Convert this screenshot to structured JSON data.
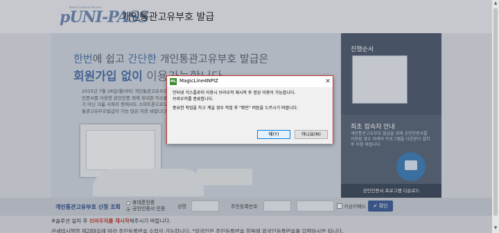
{
  "header": {
    "logo_small_text": "Korea Customs Service",
    "logo_brand": "pUNI-PASS",
    "page_title": "개인통관고유부호 발급"
  },
  "hero": {
    "line1_a": "한번",
    "line1_b": "에 쉽고 ",
    "line1_c": "간단한",
    "line1_d": " 개인통관고유부호 발급은",
    "line2_a": "회원가입 없이",
    "line2_b": " 이용가능합니다",
    "paragraph": "2015년 7월 28일(월)부터 개인통관고유부호 공인인증서를 이용한 본인인증 외에 휴대폰 익스플로러가 아닌 크롬 사파리 등에서도 스마트폰으로도 개인통관고유부호발급이 가능 많은 이용 바랍니다."
  },
  "right_panel": {
    "title1": "진행순서",
    "title2": "최초 접속자 안내",
    "text": "개인통관고유부호 발급을 위해 공인인증서를 이용할 경우 아래의 프로그램을 다운받아 설치 후 이용 바랍니다.",
    "download_label": "공인인증서 프로그램 다운로드"
  },
  "form": {
    "title": "개인통관고유부호 신청 조회",
    "radio_phone": "휴대폰인증",
    "radio_cert": "공인인증서 인증",
    "name_label": "성명",
    "reg_label": "주민등록번호",
    "keyboard_label": "가상키패드",
    "confirm_label": "확인",
    "confirm_icon": "check-icon"
  },
  "notices": {
    "notice1_a": "※솔루션 설치 후 ",
    "notice1_b": "브라우저를 재시작",
    "notice1_c": "해주시기 바랍니다.",
    "notice2": "관세법시행령 제289조에 따라 주민등록번호 수집이 가능합니다.  *외국인은 주민등록번호 항목에 외국인등록번호를 입력하시면 됩니다."
  },
  "dialog": {
    "app_icon_text": "ML",
    "title": "MagicLine4NPIZ",
    "close_glyph": "✕",
    "line1": "인터넷 익스플로러 이용시 브라우저 재시작 후 정상 이용이 가능합니다.",
    "line2": "브라우저를 종료합니다.",
    "line3": "중요한 작업을 하고 계실 경우 작업 후 \"확인\" 버튼을 누르시기 바랍니다.",
    "yes_label": "예(Y)",
    "no_label": "아니요(N)"
  },
  "scrollbar": {
    "up_glyph": "▲",
    "down_glyph": "▼"
  }
}
